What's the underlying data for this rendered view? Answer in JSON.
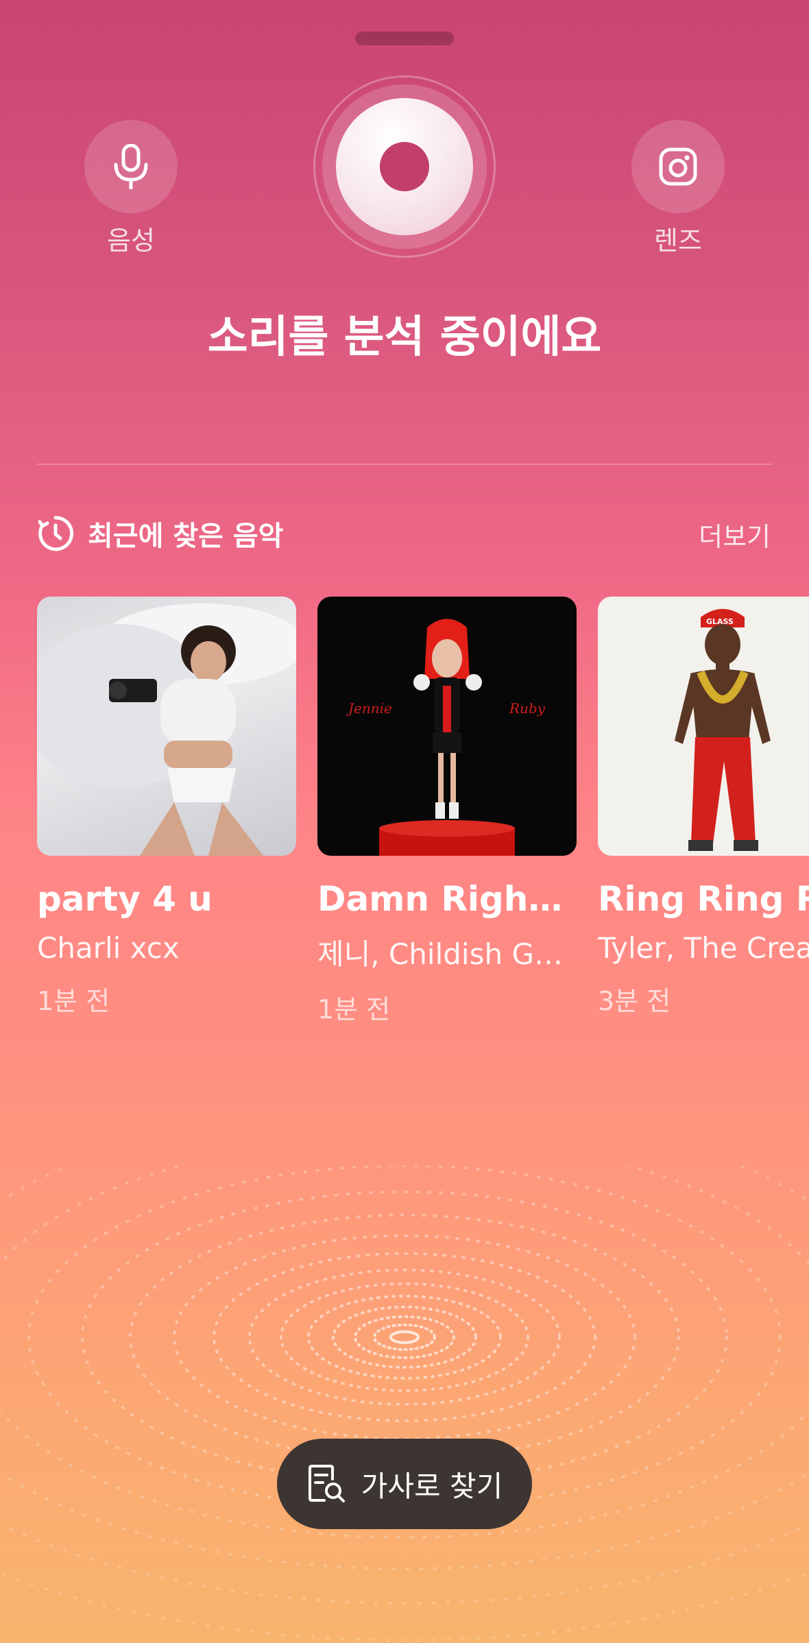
{
  "top": {
    "voice_label": "음성",
    "lens_label": "렌즈",
    "status_text": "소리를 분석 중이에요"
  },
  "recent": {
    "title": "최근에 찾은 음악",
    "more_label": "더보기",
    "items": [
      {
        "title": "party 4 u",
        "artist": "Charli xcx",
        "time": "1분 전"
      },
      {
        "title": "Damn Right (f...",
        "artist": "제니, Childish Ga...",
        "time": "1분 전",
        "cover_left_text": "Jennie",
        "cover_right_text": "Ruby"
      },
      {
        "title": "Ring Ring Ring",
        "artist": "Tyler, The Creator",
        "time": "3분 전",
        "cover_cap_text": "GLASS"
      }
    ]
  },
  "bottom": {
    "lyrics_button_label": "가사로 찾기"
  },
  "colors": {
    "top_gradient": "#c84472",
    "bottom_gradient": "#f8b56d",
    "record_dot": "#c23f6c",
    "pill_bg": "#3d3532"
  },
  "icons": [
    "microphone-icon",
    "lens-icon",
    "record-icon",
    "history-icon",
    "lyrics-search-icon"
  ]
}
